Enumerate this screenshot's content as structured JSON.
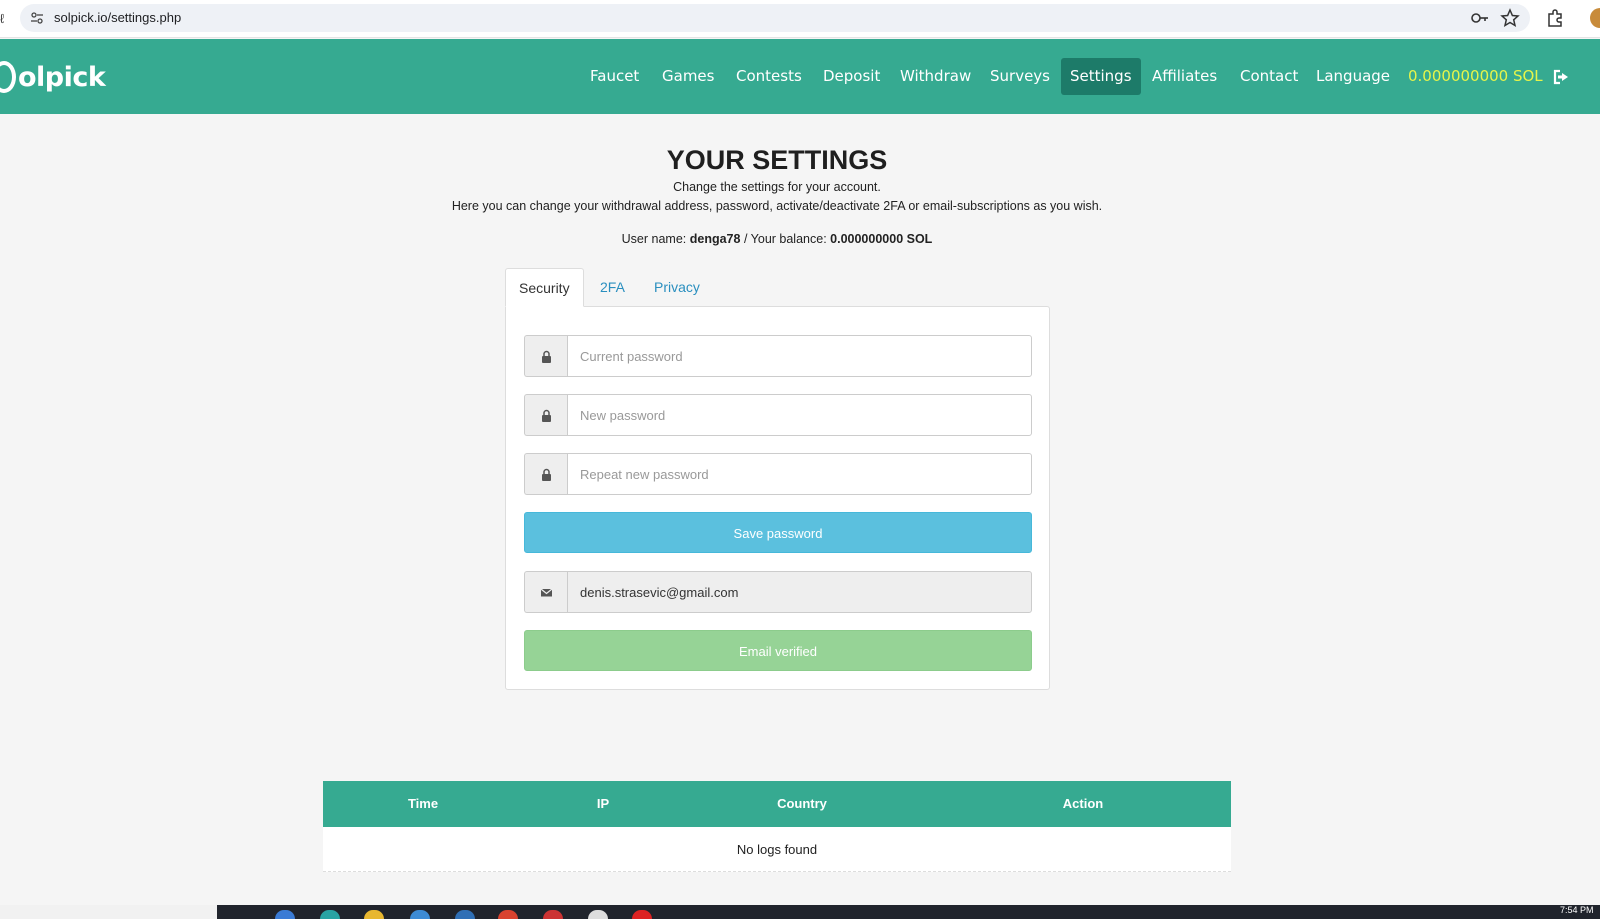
{
  "browser": {
    "url": "solpick.io/settings.php"
  },
  "header": {
    "logo_text": "olpick",
    "nav": [
      {
        "label": "Faucet"
      },
      {
        "label": "Games"
      },
      {
        "label": "Contests"
      },
      {
        "label": "Deposit"
      },
      {
        "label": "Withdraw"
      },
      {
        "label": "Surveys"
      },
      {
        "label": "Settings",
        "active": true
      },
      {
        "label": "Affiliates"
      },
      {
        "label": "Contact"
      },
      {
        "label": "Language"
      }
    ],
    "balance": "0.000000000 SOL",
    "colors": {
      "header_bg": "#36aa91",
      "active_bg": "#1d7b69",
      "balance": "#e6f54a"
    }
  },
  "main": {
    "title": "YOUR SETTINGS",
    "subtitle_1": "Change the settings for your account.",
    "subtitle_2": "Here you can change your withdrawal address, password, activate/deactivate 2FA or email-subscriptions as you wish.",
    "user_label": "User name:",
    "username": "denga78",
    "balance_label": "/ Your balance:",
    "balance": "0.000000000 SOL",
    "tabs": [
      {
        "label": "Security",
        "active": true
      },
      {
        "label": "2FA"
      },
      {
        "label": "Privacy"
      }
    ],
    "fields": {
      "current_password_placeholder": "Current password",
      "new_password_placeholder": "New password",
      "repeat_password_placeholder": "Repeat new password",
      "email_value": "denis.strasevic@gmail.com"
    },
    "save_password_label": "Save password",
    "email_verified_label": "Email verified"
  },
  "logs": {
    "columns": [
      "Time",
      "IP",
      "Country",
      "Action"
    ],
    "empty_text": "No logs found"
  },
  "taskbar": {
    "clock": "7:54 PM"
  }
}
